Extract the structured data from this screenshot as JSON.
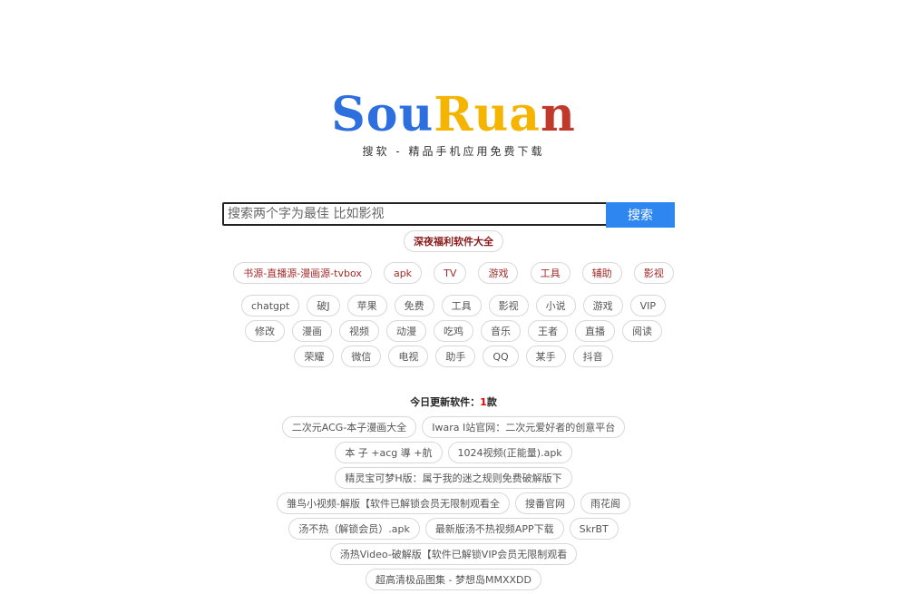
{
  "logo": {
    "letters": [
      {
        "char": "S",
        "color": "#2e6fe0"
      },
      {
        "char": "o",
        "color": "#2e6fe0"
      },
      {
        "char": "u",
        "color": "#2e6fe0"
      },
      {
        "char": "R",
        "color": "#f4b400"
      },
      {
        "char": "u",
        "color": "#f4b400"
      },
      {
        "char": "a",
        "color": "#f4b400"
      },
      {
        "char": "n",
        "color": "#c0392b"
      }
    ]
  },
  "tagline": "搜软 - 精品手机应用免费下载",
  "search": {
    "placeholder": "搜索两个字为最佳 比如影视",
    "value": "",
    "button_label": "搜索"
  },
  "feature_link": "深夜福利软件大全",
  "categories": [
    "书源-直播源-漫画源-tvbox",
    "apk",
    "TV",
    "游戏",
    "工具",
    "辅助",
    "影视"
  ],
  "tags": [
    "chatgpt",
    "破J",
    "苹果",
    "免费",
    "工具",
    "影视",
    "小说",
    "游戏",
    "VIP",
    "修改",
    "漫画",
    "视频",
    "动漫",
    "吃鸡",
    "音乐",
    "王者",
    "直播",
    "阅读",
    "荣耀",
    "微信",
    "电视",
    "助手",
    "QQ",
    "某手",
    "抖音"
  ],
  "today": {
    "label": "今日更新软件：",
    "count": "1",
    "unit": "款"
  },
  "updates": [
    "二次元ACG-本子漫画大全",
    "Iwara I站官网：二次元爱好者的创意平台",
    "本 子 +acg 導 +航",
    "1024视频(正能量).apk",
    "精灵宝可梦H版：属于我的迷之规则免费破解版下",
    "雏鸟小视频-解版【软件已解锁会员无限制观看全",
    "搜番官网",
    "雨花阁",
    "汤不热（解锁会员）.apk",
    "最新版汤不热视频APP下载",
    "SkrBT",
    "汤热Video-破解版【软件已解锁VIP会员无限制观看",
    "超高清极品图集 - 梦想岛MMXXDD"
  ],
  "colors": {
    "accent": "#2e86f0",
    "category_text": "#a52a2a",
    "count": "#dd0000"
  }
}
